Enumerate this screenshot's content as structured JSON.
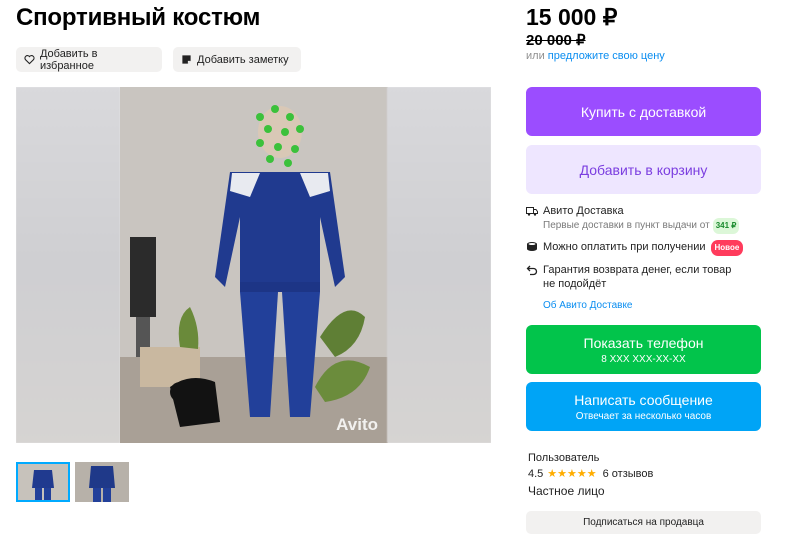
{
  "listing": {
    "title": "Спортивный костюм",
    "add_to_favorites": "Добавить в избранное",
    "add_note": "Добавить заметку",
    "watermark": "Avito"
  },
  "pricing": {
    "price": "15 000 ₽",
    "old_price": "20 000 ₽",
    "offer_prefix": "или",
    "offer_link": "предложите свою цену"
  },
  "actions": {
    "buy_with_delivery": "Купить с доставкой",
    "add_to_cart": "Добавить в корзину",
    "show_phone": "Показать телефон",
    "phone_masked": "8 XXX XXX-XX-XX",
    "write_message": "Написать сообщение",
    "reply_time": "Отвечает за несколько часов",
    "subscribe": "Подписаться на продавца"
  },
  "delivery": {
    "title": "Авито Доставка",
    "first_delivery_text": "Первые доставки в пункт выдачи от",
    "first_delivery_price": "341 ₽",
    "pay_on_receipt": "Можно оплатить при получении",
    "new_badge": "Новое",
    "refund_line1": "Гарантия возврата денег, если товар",
    "refund_line2": "не подойдёт",
    "about_link": "Об Авито Доставке"
  },
  "seller": {
    "name": "Пользователь",
    "rating": "4.5",
    "stars": "★★★★★",
    "reviews": "6 отзывов",
    "type": "Частное лицо"
  },
  "colors": {
    "buy": "#9b4dff",
    "cart_bg": "#eee6ff",
    "phone": "#02c44b",
    "message": "#00a4f6",
    "link": "#0a8df0",
    "thumb_selected": "#00aaff"
  }
}
